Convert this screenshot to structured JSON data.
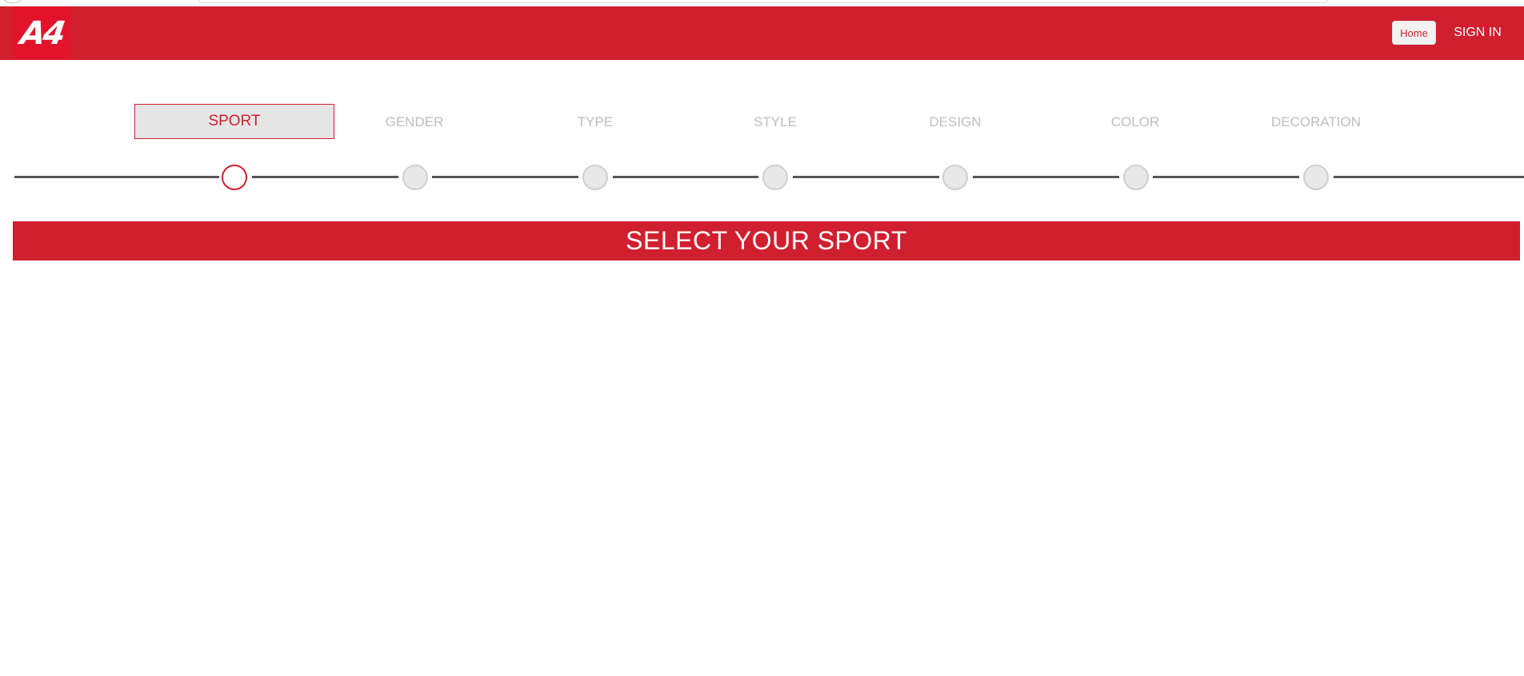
{
  "header": {
    "logo_text": "A4",
    "home_label": "Home",
    "signin_label": "SIGN IN",
    "brand_color": "#d01f2f"
  },
  "steps": [
    {
      "label": "SPORT",
      "active": true
    },
    {
      "label": "GENDER",
      "active": false
    },
    {
      "label": "TYPE",
      "active": false
    },
    {
      "label": "STYLE",
      "active": false
    },
    {
      "label": "DESIGN",
      "active": false
    },
    {
      "label": "COLOR",
      "active": false
    },
    {
      "label": "DECORATION",
      "active": false
    }
  ],
  "banner": {
    "title": "SELECT YOUR SPORT"
  }
}
